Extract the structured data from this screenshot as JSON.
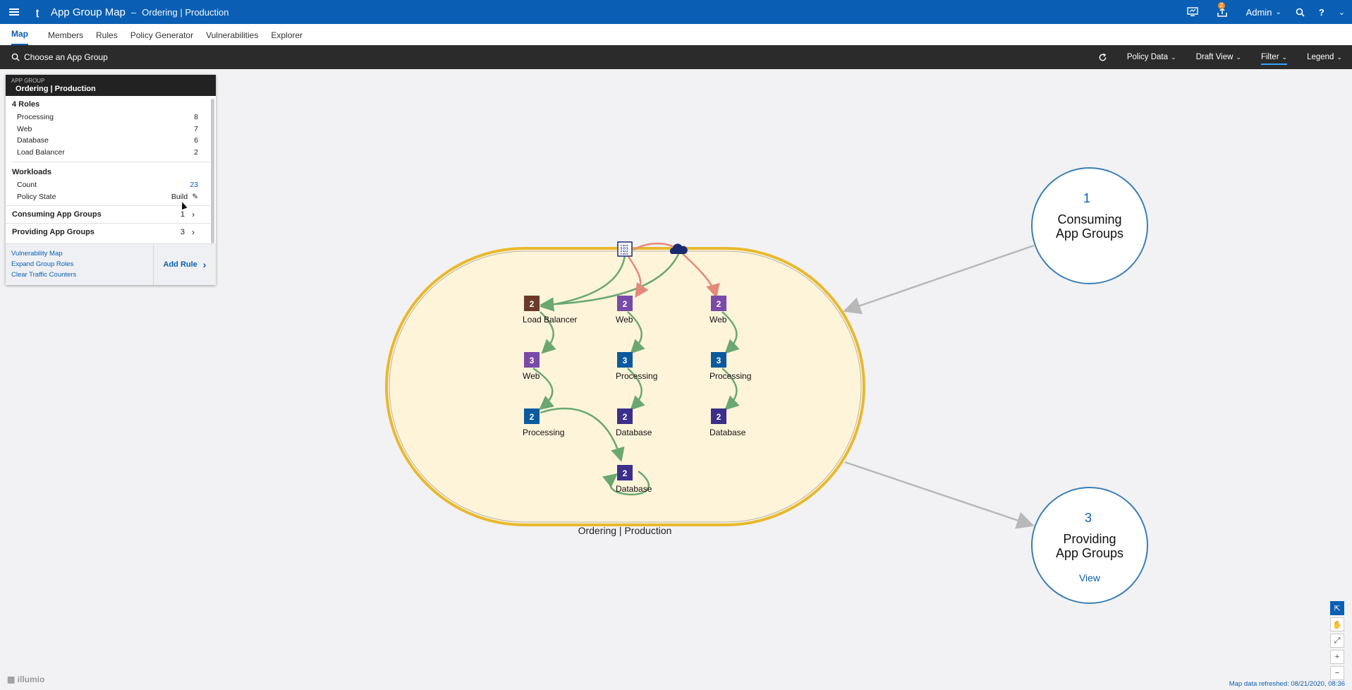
{
  "header": {
    "title": "App Group Map",
    "separator": "–",
    "subtitle": "Ordering | Production",
    "notifications_count": "2",
    "user_label": "Admin",
    "help_label": "?"
  },
  "tabs": [
    {
      "label": "Map",
      "active": true
    },
    {
      "label": "Members"
    },
    {
      "label": "Rules"
    },
    {
      "label": "Policy Generator"
    },
    {
      "label": "Vulnerabilities"
    },
    {
      "label": "Explorer"
    }
  ],
  "toolbar": {
    "search_placeholder": "Choose an App Group",
    "policy_data": "Policy Data",
    "draft_view": "Draft View",
    "filter": "Filter",
    "legend": "Legend"
  },
  "panel": {
    "label": "APP GROUP",
    "name": "Ordering | Production",
    "roles_title": "4 Roles",
    "roles": [
      {
        "name": "Processing",
        "count": "8"
      },
      {
        "name": "Web",
        "count": "7"
      },
      {
        "name": "Database",
        "count": "6"
      },
      {
        "name": "Load Balancer",
        "count": "2"
      }
    ],
    "workloads_title": "Workloads",
    "count_label": "Count",
    "count_value": "23",
    "policy_state_label": "Policy State",
    "policy_state_value": "Build",
    "consuming_label": "Consuming App Groups",
    "consuming_count": "1",
    "providing_label": "Providing App Groups",
    "providing_count": "3",
    "links": [
      "Vulnerability Map",
      "Expand Group Roles",
      "Clear Traffic Counters"
    ],
    "add_rule": "Add Rule"
  },
  "map": {
    "group_label": "Ordering | Production",
    "nodes": [
      {
        "id": "lb",
        "count": "2",
        "label": "Load Balancer",
        "color": "#6b3a2a"
      },
      {
        "id": "web1",
        "count": "2",
        "label": "Web",
        "color": "#7a4aa8"
      },
      {
        "id": "web2",
        "count": "2",
        "label": "Web",
        "color": "#7a4aa8"
      },
      {
        "id": "web3",
        "count": "3",
        "label": "Web",
        "color": "#7a4aa8"
      },
      {
        "id": "proc1",
        "count": "3",
        "label": "Processing",
        "color": "#0c5a9e"
      },
      {
        "id": "proc2",
        "count": "3",
        "label": "Processing",
        "color": "#0c5a9e"
      },
      {
        "id": "proc3",
        "count": "2",
        "label": "Processing",
        "color": "#0c5a9e"
      },
      {
        "id": "db1",
        "count": "2",
        "label": "Database",
        "color": "#3a2f8a"
      },
      {
        "id": "db2",
        "count": "2",
        "label": "Database",
        "color": "#3a2f8a"
      },
      {
        "id": "db3",
        "count": "2",
        "label": "Database",
        "color": "#3a2f8a"
      }
    ],
    "consuming": {
      "count": "1",
      "line1": "Consuming",
      "line2": "App Groups"
    },
    "providing": {
      "count": "3",
      "line1": "Providing",
      "line2": "App Groups",
      "link": "View"
    }
  },
  "colors": {
    "brand": "#0a5fb4",
    "group_fill": "#fdf4da",
    "group_border": "#e8b92f",
    "flow_allowed": "#6aa870",
    "flow_blocked": "#e38a7a"
  },
  "footer": {
    "brand": "illumio",
    "refreshed": "Map data refreshed: 08/21/2020, 08:36"
  }
}
